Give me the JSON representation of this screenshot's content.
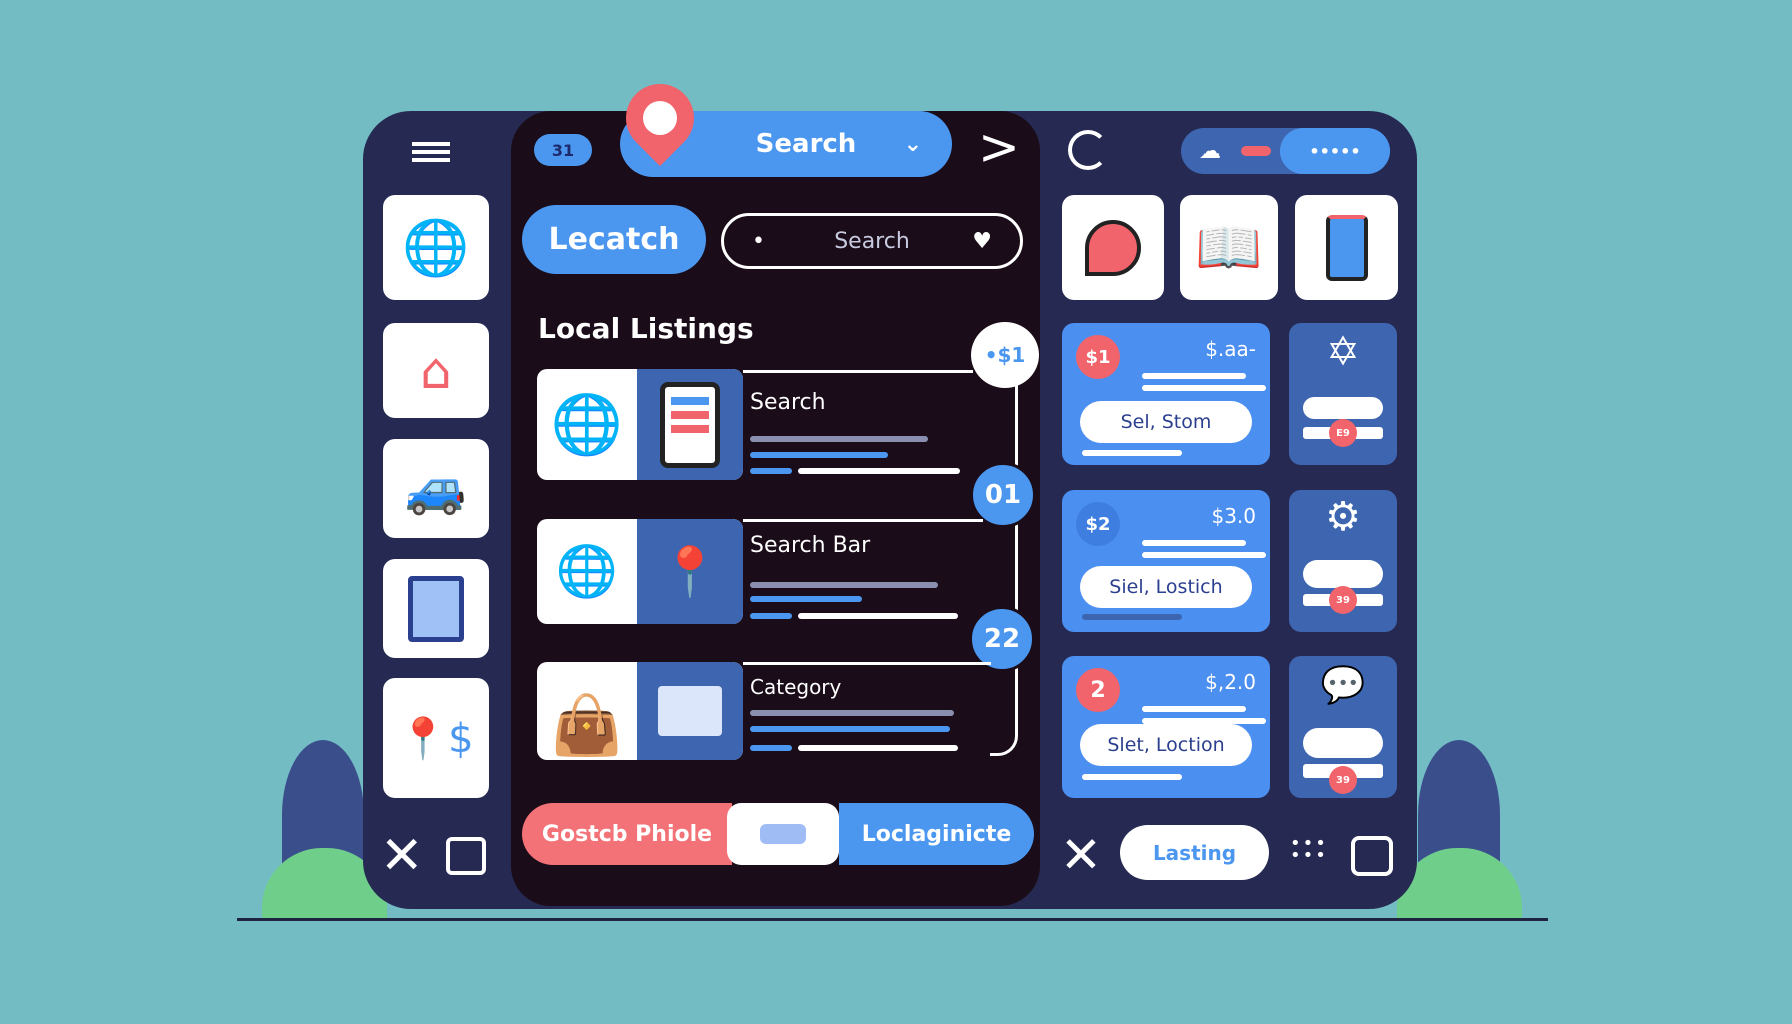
{
  "top": {
    "badge": "31",
    "search_label": "Search",
    "chevron": "chevron-down-icon"
  },
  "filters": {
    "primary_button": "Lecatch",
    "search_placeholder": "Search"
  },
  "section_title": "Local Listings",
  "listings": [
    {
      "title": "Search",
      "badge": "01"
    },
    {
      "title": "Search Bar",
      "badge": "22"
    },
    {
      "title": "Category",
      "badge": ""
    }
  ],
  "top_badge": "•$1",
  "bottom_bar": {
    "left": "Gostcb Phiole",
    "right": "Loclaginicte"
  },
  "right": {
    "price_cards": [
      {
        "badge": "$1",
        "price": "$.aa-",
        "button": "Sel, Stom"
      },
      {
        "badge": "$2",
        "price": "$3.0",
        "button": "Siel, Lostich"
      },
      {
        "badge": "2",
        "price": "$,2.0",
        "button": "Slet, Loction"
      }
    ],
    "small_badges": [
      "E9",
      "39",
      "39"
    ],
    "bottom_button": "Lasting"
  },
  "colors": {
    "accent": "#4b97f0",
    "coral": "#f2646b",
    "frame": "#262a52",
    "panel": "#1a0c18",
    "background": "#73bcc3"
  }
}
